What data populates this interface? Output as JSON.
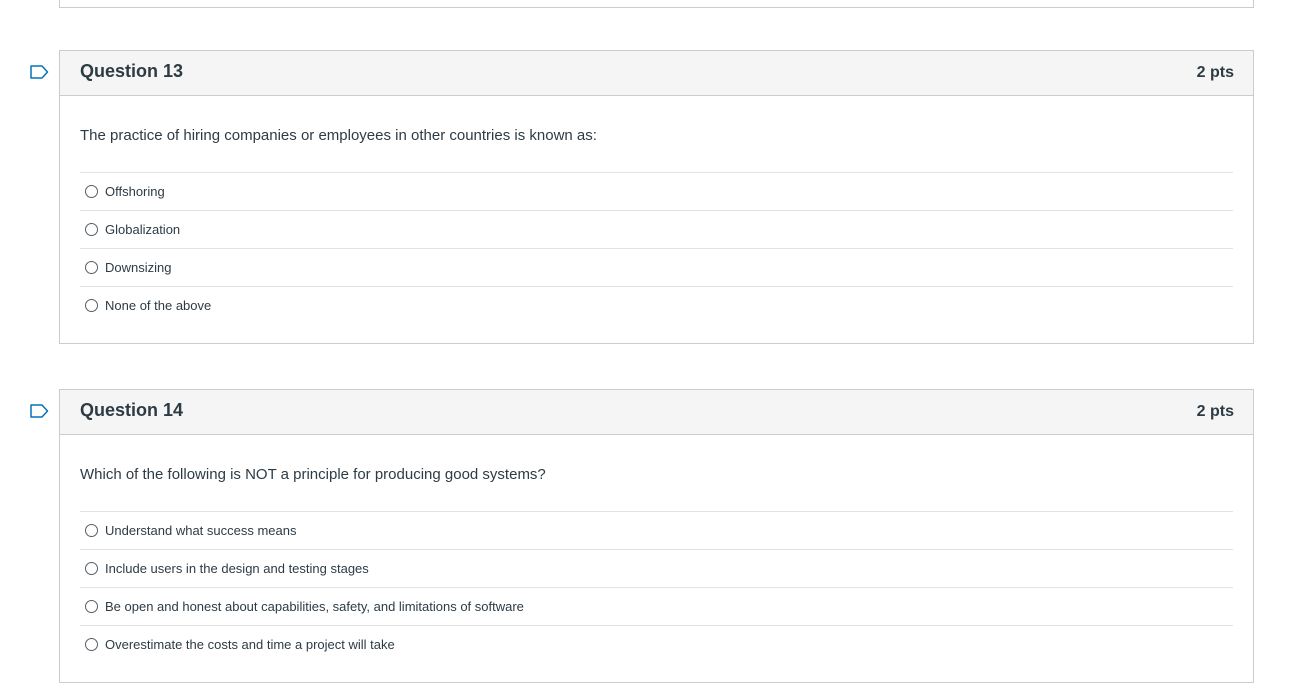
{
  "questions": [
    {
      "title": "Question 13",
      "points": "2 pts",
      "text": "The practice of hiring companies or employees in other countries is known as:",
      "answers": [
        "Offshoring",
        "Globalization",
        "Downsizing",
        "None of the above"
      ]
    },
    {
      "title": "Question 14",
      "points": "2 pts",
      "text": "Which of the following is NOT a principle for producing good systems?",
      "answers": [
        "Understand what success means",
        "Include users in the design and testing stages",
        "Be open and honest about capabilities, safety, and limitations of software",
        "Overestimate the costs and time a project will take"
      ]
    }
  ],
  "icons": {
    "flag": "flag-question-icon",
    "radio": "radio-button"
  },
  "colors": {
    "border": "#c7cdd1",
    "header_bg": "#f5f5f5",
    "text": "#2d3b45",
    "divider": "#dfe3e6"
  }
}
